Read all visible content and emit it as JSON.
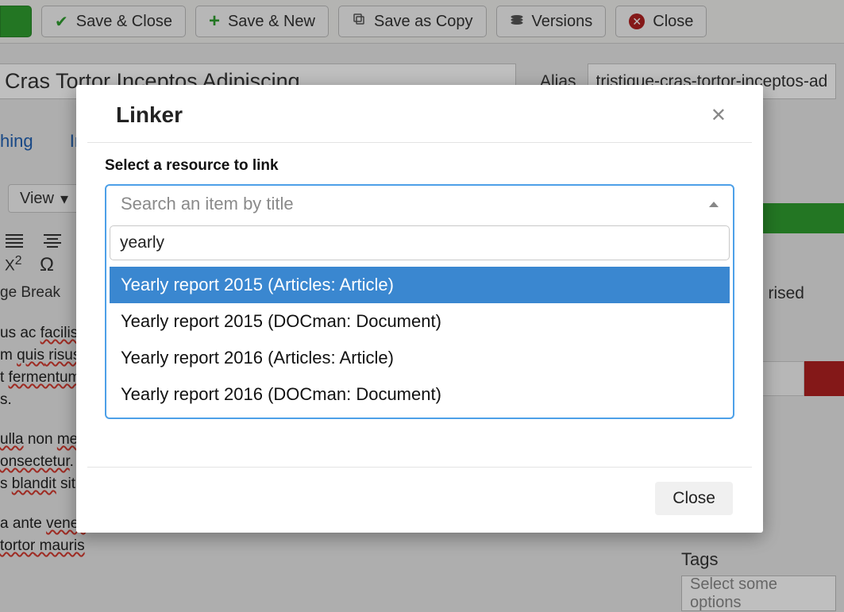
{
  "toolbar": {
    "save_close": "Save & Close",
    "save_new": "Save & New",
    "save_copy": "Save as Copy",
    "versions": "Versions",
    "close": "Close"
  },
  "title": {
    "value": "Cras Tortor Inceptos Adipiscing",
    "alias_label": "Alias",
    "alias_value": "tristique-cras-tortor-inceptos-adipis"
  },
  "tabs": {
    "thing": "hing",
    "ima": "Ima"
  },
  "editor": {
    "view": "View",
    "gebreak": "ge Break",
    "body": {
      "p1a": "us ac ",
      "p1b": "facilisis",
      "p1c": "m ",
      "p1d": "quis",
      "p1e": " risus",
      "p1f": "t ",
      "p1g": "fermentum",
      "p1h": "s.",
      "p2a": "ulla",
      "p2b": " non ",
      "p2c": "metu",
      "p2d": "onsectetur",
      "p2e": ". A",
      "p2f": "s ",
      "p2g": "blandit",
      "p2h": " sit a",
      "p3a": "a ante ",
      "p3b": "venen",
      "p3c": "tortor",
      "p3d": " mauris"
    }
  },
  "rightside": {
    "rtxt": "rised"
  },
  "modal": {
    "title": "Linker",
    "label": "Select a resource to link",
    "placeholder": "Search an item by title",
    "search_value": "yearly",
    "options": [
      "Yearly report 2015 (Articles: Article)",
      "Yearly report 2015 (DOCman: Document)",
      "Yearly report 2016 (Articles: Article)",
      "Yearly report 2016 (DOCman: Document)"
    ],
    "close": "Close"
  },
  "tags": {
    "label": "Tags",
    "placeholder": "Select some options"
  }
}
